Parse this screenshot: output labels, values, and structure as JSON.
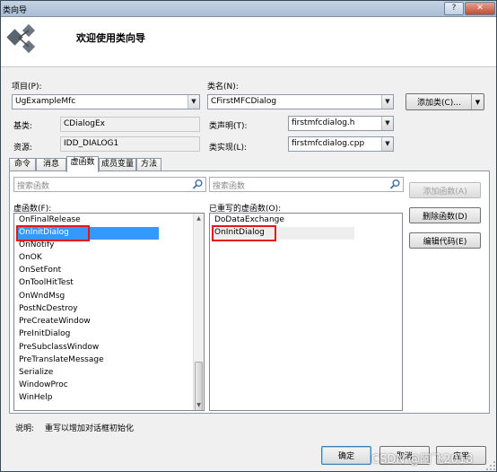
{
  "window": {
    "title": "类向导",
    "help_label": "?",
    "close_label": "✕"
  },
  "header": {
    "heading": "欢迎使用类向导",
    "logo_icon": "class-wizard-logo-icon"
  },
  "project": {
    "label": "项目(P):",
    "value": "UgExampleMfc"
  },
  "classname": {
    "label": "类名(N):",
    "value": "CFirstMFCDialog"
  },
  "add_class_button": "添加类(C)...",
  "base_class": {
    "label": "基类:",
    "value": "CDialogEx"
  },
  "resource": {
    "label": "资源:",
    "value": "IDD_DIALOG1"
  },
  "class_declaration": {
    "label": "类声明(T):",
    "value": "firstmfcdialog.h"
  },
  "class_implementation": {
    "label": "类实现(L):",
    "value": "firstmfcdialog.cpp"
  },
  "tabs": [
    "命令",
    "消息",
    "虚函数",
    "成员变量",
    "方法"
  ],
  "active_tab": 2,
  "search_left": {
    "placeholder": "搜索函数"
  },
  "search_right": {
    "placeholder": "搜索函数"
  },
  "virtual_functions": {
    "label": "虚函数(F):",
    "items": [
      "OnFinalRelease",
      "OnInitDialog",
      "OnNotify",
      "OnOK",
      "OnSetFont",
      "OnToolHitTest",
      "OnWndMsg",
      "PostNcDestroy",
      "PreCreateWindow",
      "PreInitDialog",
      "PreSubclassWindow",
      "PreTranslateMessage",
      "Serialize",
      "WindowProc",
      "WinHelp"
    ],
    "selected_index": 1
  },
  "overridden_functions": {
    "label": "已重写的虚函数(O):",
    "items": [
      "DoDataExchange",
      "OnInitDialog"
    ],
    "selected_index": 1
  },
  "buttons": {
    "add_function": "添加函数(A)",
    "delete_function": "删除函数(D)",
    "edit_code": "编辑代码(E)"
  },
  "description": {
    "label": "说明:",
    "text": "重写以增加对话框初始化"
  },
  "footer": {
    "ok": "确定",
    "cancel": "取消",
    "apply": "应用"
  },
  "watermark": "CSDN @阿飞2018",
  "colors": {
    "selection": "#3399ff",
    "highlight_box": "#e8141b",
    "title_gradient_top": "#c4d3e4"
  }
}
